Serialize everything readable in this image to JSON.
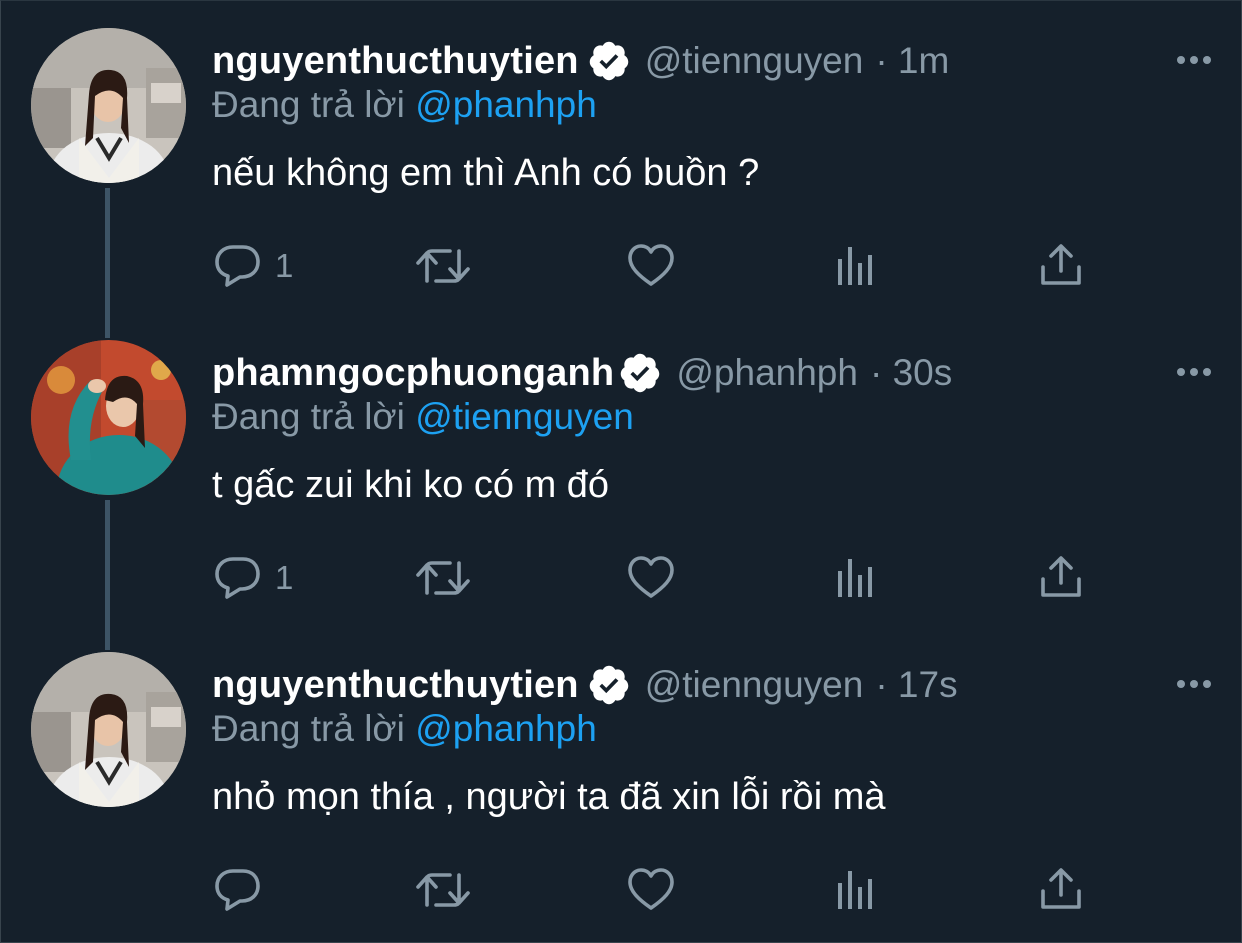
{
  "thread": {
    "replying_label": "Đang trả lời",
    "tweets": [
      {
        "name": "nguyenthucthuytien",
        "handle": "@tiennguyen",
        "time": "· 1m",
        "replying_to": "@phanhph",
        "text": "nếu không em thì Anh có buồn ?",
        "reply_count": "1"
      },
      {
        "name": "phamngocphuonganh",
        "handle": "@phanhph",
        "time": "· 30s",
        "replying_to": "@tiennguyen",
        "text": "t gấc zui khi ko có m đó",
        "reply_count": "1"
      },
      {
        "name": "nguyenthucthuytien",
        "handle": "@tiennguyen",
        "time": "· 17s",
        "replying_to": "@phanhph",
        "text": "nhỏ mọn thía , người ta đã xin lỗi rồi mà",
        "reply_count": ""
      }
    ]
  },
  "icons": {
    "verified": "verified-badge-icon",
    "more": "more-dots-icon",
    "reply": "reply-bubble-icon",
    "retweet": "retweet-icon",
    "like": "heart-icon",
    "analytics": "analytics-bars-icon",
    "share": "share-upload-icon"
  },
  "colors": {
    "background": "#15202b",
    "primary_text": "#ffffff",
    "secondary_text": "#8899a6",
    "mention": "#1da1f2",
    "thread_line": "#3d5466"
  }
}
